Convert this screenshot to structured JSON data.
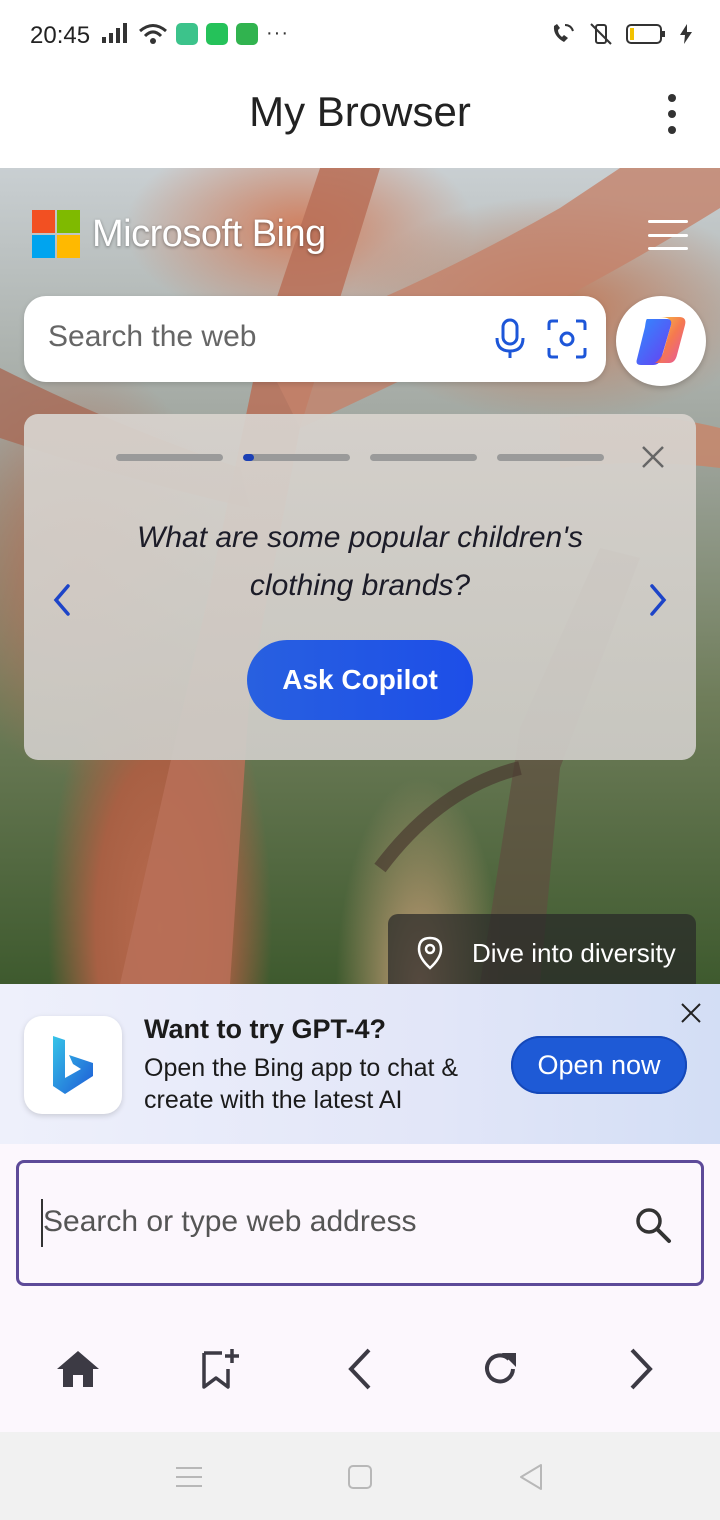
{
  "status_bar": {
    "time": "20:45",
    "dots": "···"
  },
  "app_bar": {
    "title": "My Browser"
  },
  "bing": {
    "logo_text": "Microsoft Bing",
    "search_placeholder": "Search the web",
    "logo_colors": [
      "#f25022",
      "#7fba00",
      "#00a4ef",
      "#ffb900"
    ]
  },
  "prompt_card": {
    "question": "What are some popular children's clothing brands?",
    "button_label": "Ask Copilot",
    "progress": [
      0,
      0.1,
      0,
      0
    ],
    "accent_color": "#1b3fb5"
  },
  "photo_caption": {
    "text": "Dive into diversity"
  },
  "promo": {
    "title": "Want to try GPT-4?",
    "line1": "Open the Bing app to chat &",
    "line2": "create with the latest AI",
    "button_label": "Open now"
  },
  "url_bar": {
    "placeholder": "Search or type web address"
  },
  "nav": {
    "items": [
      "home-icon",
      "bookmark-add-icon",
      "back-icon",
      "refresh-icon",
      "forward-icon"
    ]
  },
  "system_nav": {
    "items": [
      "recents-icon",
      "home-square-icon",
      "back-triangle-icon"
    ]
  }
}
